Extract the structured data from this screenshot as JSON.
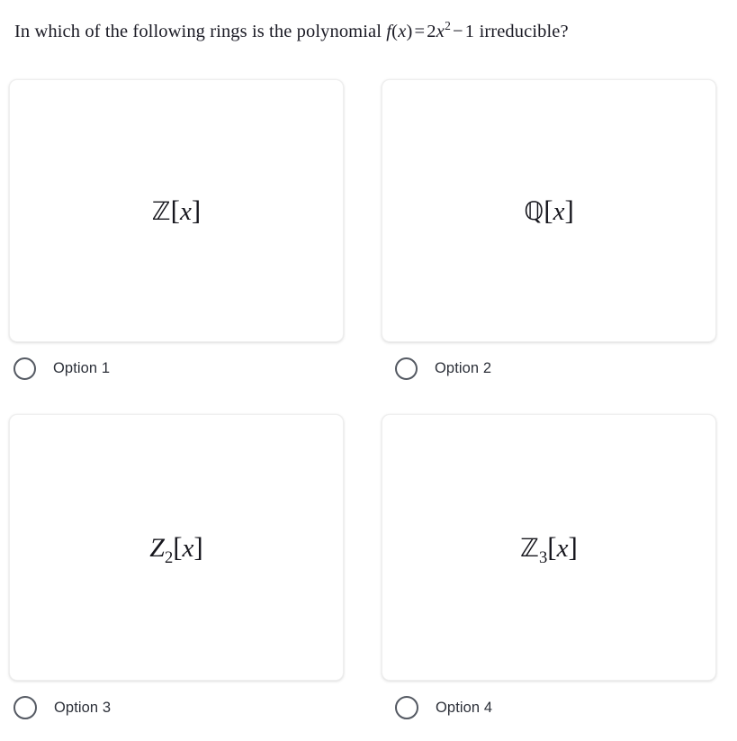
{
  "question": {
    "text_before": "In which of the following rings is the polynomial",
    "formula": {
      "function_name": "f",
      "argument": "x",
      "equals": "=",
      "coefficient": "2",
      "variable": "x",
      "exponent": "2",
      "operator": "−",
      "constant": "1",
      "plain": "f(x) = 2x² − 1"
    },
    "text_after": "irreducible?",
    "full_text": "In which of the following rings is the polynomial f(x) = 2x² − 1 irreducible?"
  },
  "options": [
    {
      "id": "option-1",
      "label": "Option 1",
      "selected": false,
      "card_math": {
        "ring": "ℤ",
        "ring_style": "blackboard-bold",
        "subscript": "",
        "bracket_open": "[",
        "variable": "x",
        "bracket_close": "]",
        "plain": "ℤ[x]"
      }
    },
    {
      "id": "option-2",
      "label": "Option 2",
      "selected": false,
      "card_math": {
        "ring": "ℚ",
        "ring_style": "blackboard-bold",
        "subscript": "",
        "bracket_open": "[",
        "variable": "x",
        "bracket_close": "]",
        "plain": "ℚ[x]"
      }
    },
    {
      "id": "option-3",
      "label": "Option 3",
      "selected": false,
      "card_math": {
        "ring": "Z",
        "ring_style": "italic-serif",
        "subscript": "2",
        "bracket_open": "[",
        "variable": "x",
        "bracket_close": "]",
        "plain": "Z₂[x]"
      }
    },
    {
      "id": "option-4",
      "label": "Option 4",
      "selected": false,
      "card_math": {
        "ring": "ℤ",
        "ring_style": "blackboard-bold",
        "subscript": "3",
        "bracket_open": "[",
        "variable": "x",
        "bracket_close": "]",
        "plain": "ℤ₃[x]"
      }
    }
  ],
  "colors": {
    "background": "#ffffff",
    "text": "#1a1a24",
    "label_text": "#2c3039",
    "radio_border": "#555a63",
    "card_border": "#efefef"
  }
}
